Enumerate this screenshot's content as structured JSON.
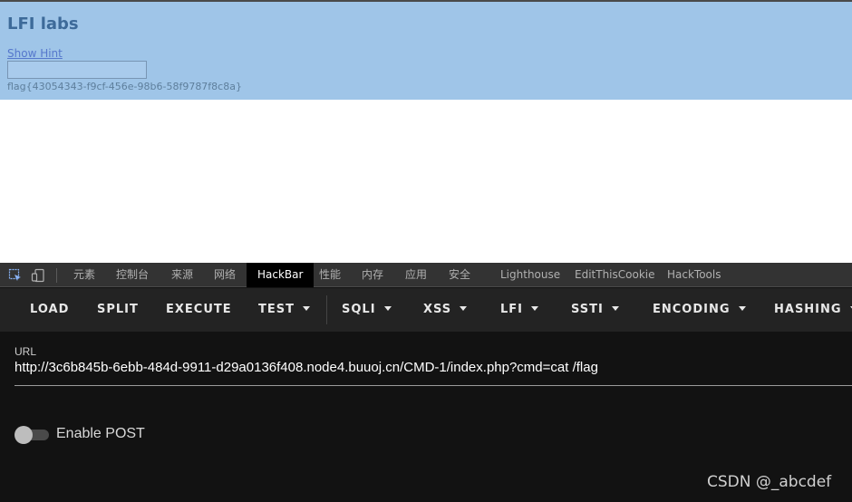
{
  "page": {
    "title": "LFI labs",
    "hint_link": "Show Hint",
    "input_value": "",
    "flag": "flag{43054343-f9cf-456e-98b6-58f9787f8c8a}"
  },
  "devtools": {
    "icons": [
      "inspect-element-icon",
      "device-toolbar-icon"
    ],
    "tabs": [
      "元素",
      "控制台",
      "来源",
      "网络",
      "HackBar",
      "性能",
      "内存",
      "应用",
      "安全",
      "Lighthouse",
      "EditThisCookie",
      "HackTools"
    ],
    "active_tab": "HackBar"
  },
  "hackbar": {
    "buttons": [
      "LOAD",
      "SPLIT",
      "EXECUTE",
      "TEST",
      "SQLI",
      "XSS",
      "LFI",
      "SSTI",
      "ENCODING",
      "HASHING"
    ],
    "url_label": "URL",
    "url_value": "http://3c6b845b-6ebb-484d-9911-d29a0136f408.node4.buuoj.cn/CMD-1/index.php?cmd=cat /flag",
    "enable_post_label": "Enable POST",
    "enable_post": false
  },
  "watermark": "CSDN @_abcdef",
  "colors": {
    "page_header_bg": "#9fc5e8",
    "title": "#3d6a99",
    "devtools_bg": "#121212",
    "toolbar_bg": "#232323",
    "tabbar_bg": "#333333"
  }
}
